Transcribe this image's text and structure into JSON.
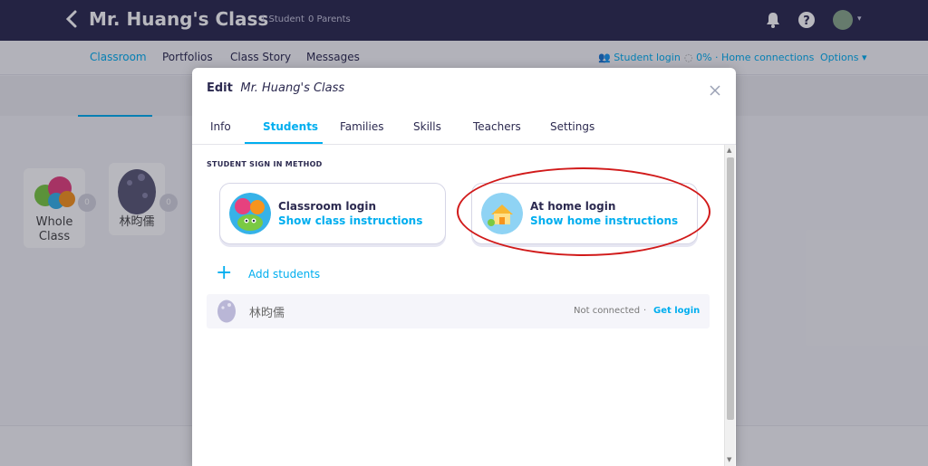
{
  "header": {
    "class_title": "Mr. Huang's Class",
    "students_count": "1 Student",
    "parents_count": "0 Parents"
  },
  "subnav": {
    "tabs": [
      "Classroom",
      "Portfolios",
      "Class Story",
      "Messages"
    ],
    "student_login": "Student login",
    "home_connections": "0% · Home connections",
    "options": "Options"
  },
  "background_cards": {
    "whole_class": "Whole Class",
    "whole_class_badge": "0",
    "student_name": "林昀儒",
    "student_badge": "0"
  },
  "modal": {
    "title_prefix": "Edit",
    "title_class": "Mr. Huang's Class",
    "tabs": [
      "Info",
      "Students",
      "Families",
      "Skills",
      "Teachers",
      "Settings"
    ],
    "active_tab": "Students",
    "section_label": "STUDENT SIGN IN METHOD",
    "classroom_login": {
      "heading": "Classroom login",
      "link": "Show class instructions"
    },
    "home_login": {
      "heading": "At home login",
      "link": "Show home instructions"
    },
    "add_students": "Add students",
    "students": [
      {
        "name": "林昀儒",
        "status": "Not connected",
        "action": "Get login"
      }
    ]
  },
  "colors": {
    "accent": "#00aeef",
    "topbar": "#2c2a50",
    "annotation": "#d11a1a"
  }
}
